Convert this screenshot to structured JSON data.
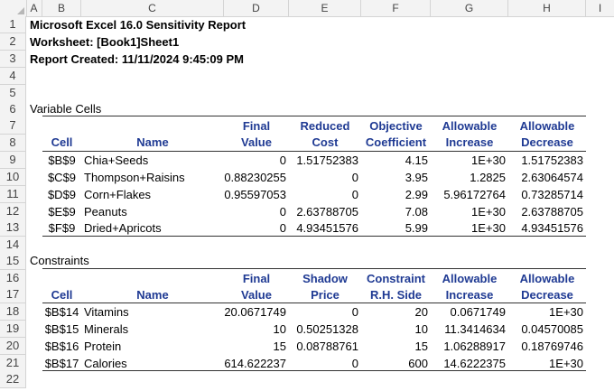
{
  "columns": [
    "A",
    "B",
    "C",
    "D",
    "E",
    "F",
    "G",
    "H",
    "I"
  ],
  "rows": [
    "1",
    "2",
    "3",
    "4",
    "5",
    "6",
    "7",
    "8",
    "9",
    "10",
    "11",
    "12",
    "13",
    "14",
    "15",
    "16",
    "17",
    "18",
    "19",
    "20",
    "21",
    "22"
  ],
  "report": {
    "title": "Microsoft Excel 16.0 Sensitivity Report",
    "worksheet": "Worksheet: [Book1]Sheet1",
    "created": "Report Created: 11/11/2024 9:45:09 PM"
  },
  "variable_cells": {
    "section_label": "Variable Cells",
    "headers_top": [
      "",
      "",
      "Final",
      "Reduced",
      "Objective",
      "Allowable",
      "Allowable"
    ],
    "headers_bottom": [
      "Cell",
      "Name",
      "Value",
      "Cost",
      "Coefficient",
      "Increase",
      "Decrease"
    ],
    "rows": [
      [
        "$B$9",
        "Chia+Seeds",
        "0",
        "1.51752383",
        "4.15",
        "1E+30",
        "1.51752383"
      ],
      [
        "$C$9",
        "Thompson+Raisins",
        "0.88230255",
        "0",
        "3.95",
        "1.2825",
        "2.63064574"
      ],
      [
        "$D$9",
        "Corn+Flakes",
        "0.95597053",
        "0",
        "2.99",
        "5.96172764",
        "0.73285714"
      ],
      [
        "$E$9",
        "Peanuts",
        "0",
        "2.63788705",
        "7.08",
        "1E+30",
        "2.63788705"
      ],
      [
        "$F$9",
        "Dried+Apricots",
        "0",
        "4.93451576",
        "5.99",
        "1E+30",
        "4.93451576"
      ]
    ]
  },
  "constraints": {
    "section_label": "Constraints",
    "headers_top": [
      "",
      "",
      "Final",
      "Shadow",
      "Constraint",
      "Allowable",
      "Allowable"
    ],
    "headers_bottom": [
      "Cell",
      "Name",
      "Value",
      "Price",
      "R.H. Side",
      "Increase",
      "Decrease"
    ],
    "rows": [
      [
        "$B$14",
        "Vitamins",
        "20.0671749",
        "0",
        "20",
        "0.0671749",
        "1E+30"
      ],
      [
        "$B$15",
        "Minerals",
        "10",
        "0.50251328",
        "10",
        "11.3414634",
        "0.04570085"
      ],
      [
        "$B$16",
        "Protein",
        "15",
        "0.08788761",
        "15",
        "1.06288917",
        "0.18769746"
      ],
      [
        "$B$17",
        "Calories",
        "614.622237",
        "0",
        "600",
        "14.6222375",
        "1E+30"
      ]
    ]
  },
  "colors": {
    "header_text": "#1f3a93",
    "grid": "#d4d4d4",
    "header_bg": "#f3f3f3"
  }
}
